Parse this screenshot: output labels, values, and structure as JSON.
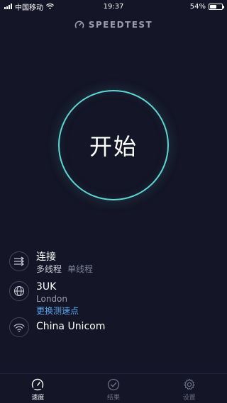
{
  "status_bar": {
    "carrier": "中国移动",
    "time": "19:37",
    "battery": "54%",
    "battery_level": 0.54
  },
  "logo": {
    "text": "SPEEDTEST"
  },
  "go_button": {
    "label": "开始"
  },
  "connections": {
    "title": "连接",
    "selected": "多线程",
    "alternative": "单线程"
  },
  "server": {
    "name": "3UK",
    "location": "London",
    "change_label": "更换测速点"
  },
  "provider": {
    "name": "China Unicom"
  },
  "bottom_nav": [
    {
      "label": "速度",
      "icon": "speedometer-icon",
      "active": true
    },
    {
      "label": "结果",
      "icon": "checkmark-circle-icon",
      "active": false
    },
    {
      "label": "设置",
      "icon": "gear-icon",
      "active": false
    }
  ]
}
